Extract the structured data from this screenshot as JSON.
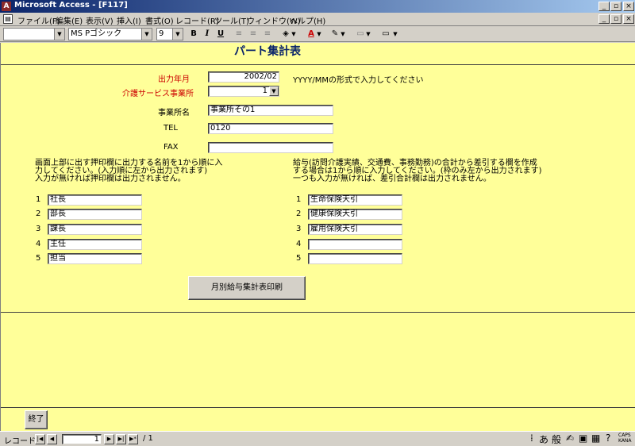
{
  "window": {
    "title": "Microsoft Access - [F117]",
    "app_icon": "access-icon",
    "controls": [
      "_",
      "▫",
      "×"
    ],
    "doc_controls": [
      "_",
      "▫",
      "×"
    ]
  },
  "menu": {
    "items": [
      "ファイル(F)",
      "編集(E)",
      "表示(V)",
      "挿入(I)",
      "書式(O)",
      "レコード(R)",
      "ツール(T)",
      "ウィンドウ(W)",
      "ヘルプ(H)"
    ]
  },
  "toolbar": {
    "object_combo": "",
    "font_name": "MS Pゴシック",
    "font_size": "9",
    "bold": "B",
    "italic": "I",
    "underline": "U",
    "align_left": "≡",
    "align_center": "≡",
    "align_right": "≡"
  },
  "form": {
    "title": "パート集計表",
    "output_month_label": "出力年月",
    "output_month_value": "2002/02",
    "output_month_hint": "YYYY/MMの形式で入力してください",
    "office_label": "介護サービス事業所",
    "office_value": "1",
    "office_name_label": "事業所名",
    "office_name_value": "事業所その1",
    "tel_label": "TEL",
    "tel_value": "0120",
    "fax_label": "FAX",
    "fax_value": "",
    "stamp_note": [
      "画面上部に出す押印欄に出力する名前を1から順に入",
      "力してください。(入力順に左から出力されます)",
      "入力が無ければ押印欄は出力されません。"
    ],
    "deduction_note": [
      "給与(訪問介護実績、交通費、事務勤務)の合計から差引する欄を作成",
      "する場合は1から順に入力してください。(枠のみ左から出力されます)",
      "一つも入力が無ければ、差引合計欄は出力されません。"
    ],
    "stamps": [
      {
        "no": "1",
        "value": "社長"
      },
      {
        "no": "2",
        "value": "部長"
      },
      {
        "no": "3",
        "value": "課長"
      },
      {
        "no": "4",
        "value": "主任"
      },
      {
        "no": "5",
        "value": "担当"
      }
    ],
    "deductions": [
      {
        "no": "1",
        "value": "生命保険天引"
      },
      {
        "no": "2",
        "value": "健康保険天引"
      },
      {
        "no": "3",
        "value": "雇用保険天引"
      },
      {
        "no": "4",
        "value": ""
      },
      {
        "no": "5",
        "value": ""
      }
    ],
    "print_button": "月別給与集計表印刷",
    "close_button": "終了"
  },
  "status": {
    "record_label": "レコード:",
    "record_value": "1",
    "record_total": "/ 1",
    "ime": [
      "あ",
      "般"
    ],
    "caps": "CAPS",
    "kana": "KANA"
  }
}
